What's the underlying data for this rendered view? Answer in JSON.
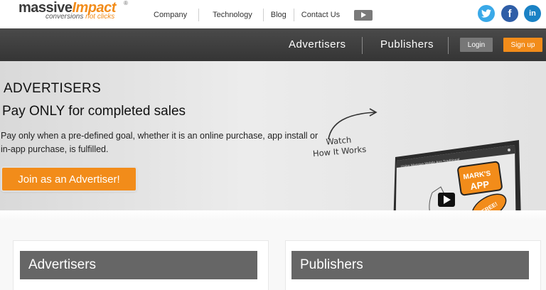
{
  "logo": {
    "word_main": "massive",
    "word_accent": "Impact",
    "registered": "®",
    "tagline_1": "conversions",
    "tagline_2": "not clicks"
  },
  "top_nav": {
    "items": [
      "Company",
      "Technology",
      "Blog",
      "Contact Us"
    ],
    "video_icon": "play-icon"
  },
  "social": {
    "twitter": "t",
    "facebook": "f",
    "linkedin": "in"
  },
  "main_nav": {
    "advertisers": "Advertisers",
    "publishers": "Publishers",
    "login": "Login",
    "signup": "Sign up"
  },
  "hero": {
    "kicker": "ADVERTISERS",
    "headline": "Pay ONLY for completed sales",
    "description": "Pay only when a pre-defined goal, whether it is an online purchase, app install or in-app purchase, is fulfilled.",
    "cta": "Join as an Advertiser!",
    "watch_line1": "Watch",
    "watch_line2": "How It Works",
    "video_badge_1": "MARK'S",
    "video_badge_2": "APP",
    "video_badge_3": "FREE!"
  },
  "sections": {
    "advertisers_title": "Advertisers",
    "publishers_title": "Publishers"
  },
  "colors": {
    "brand_orange": "#f28c1a",
    "nav_dark": "#3e3e3e",
    "band_gray": "#666666",
    "twitter": "#3aa9e8",
    "facebook": "#2f5ea7",
    "linkedin": "#1a82c5"
  }
}
